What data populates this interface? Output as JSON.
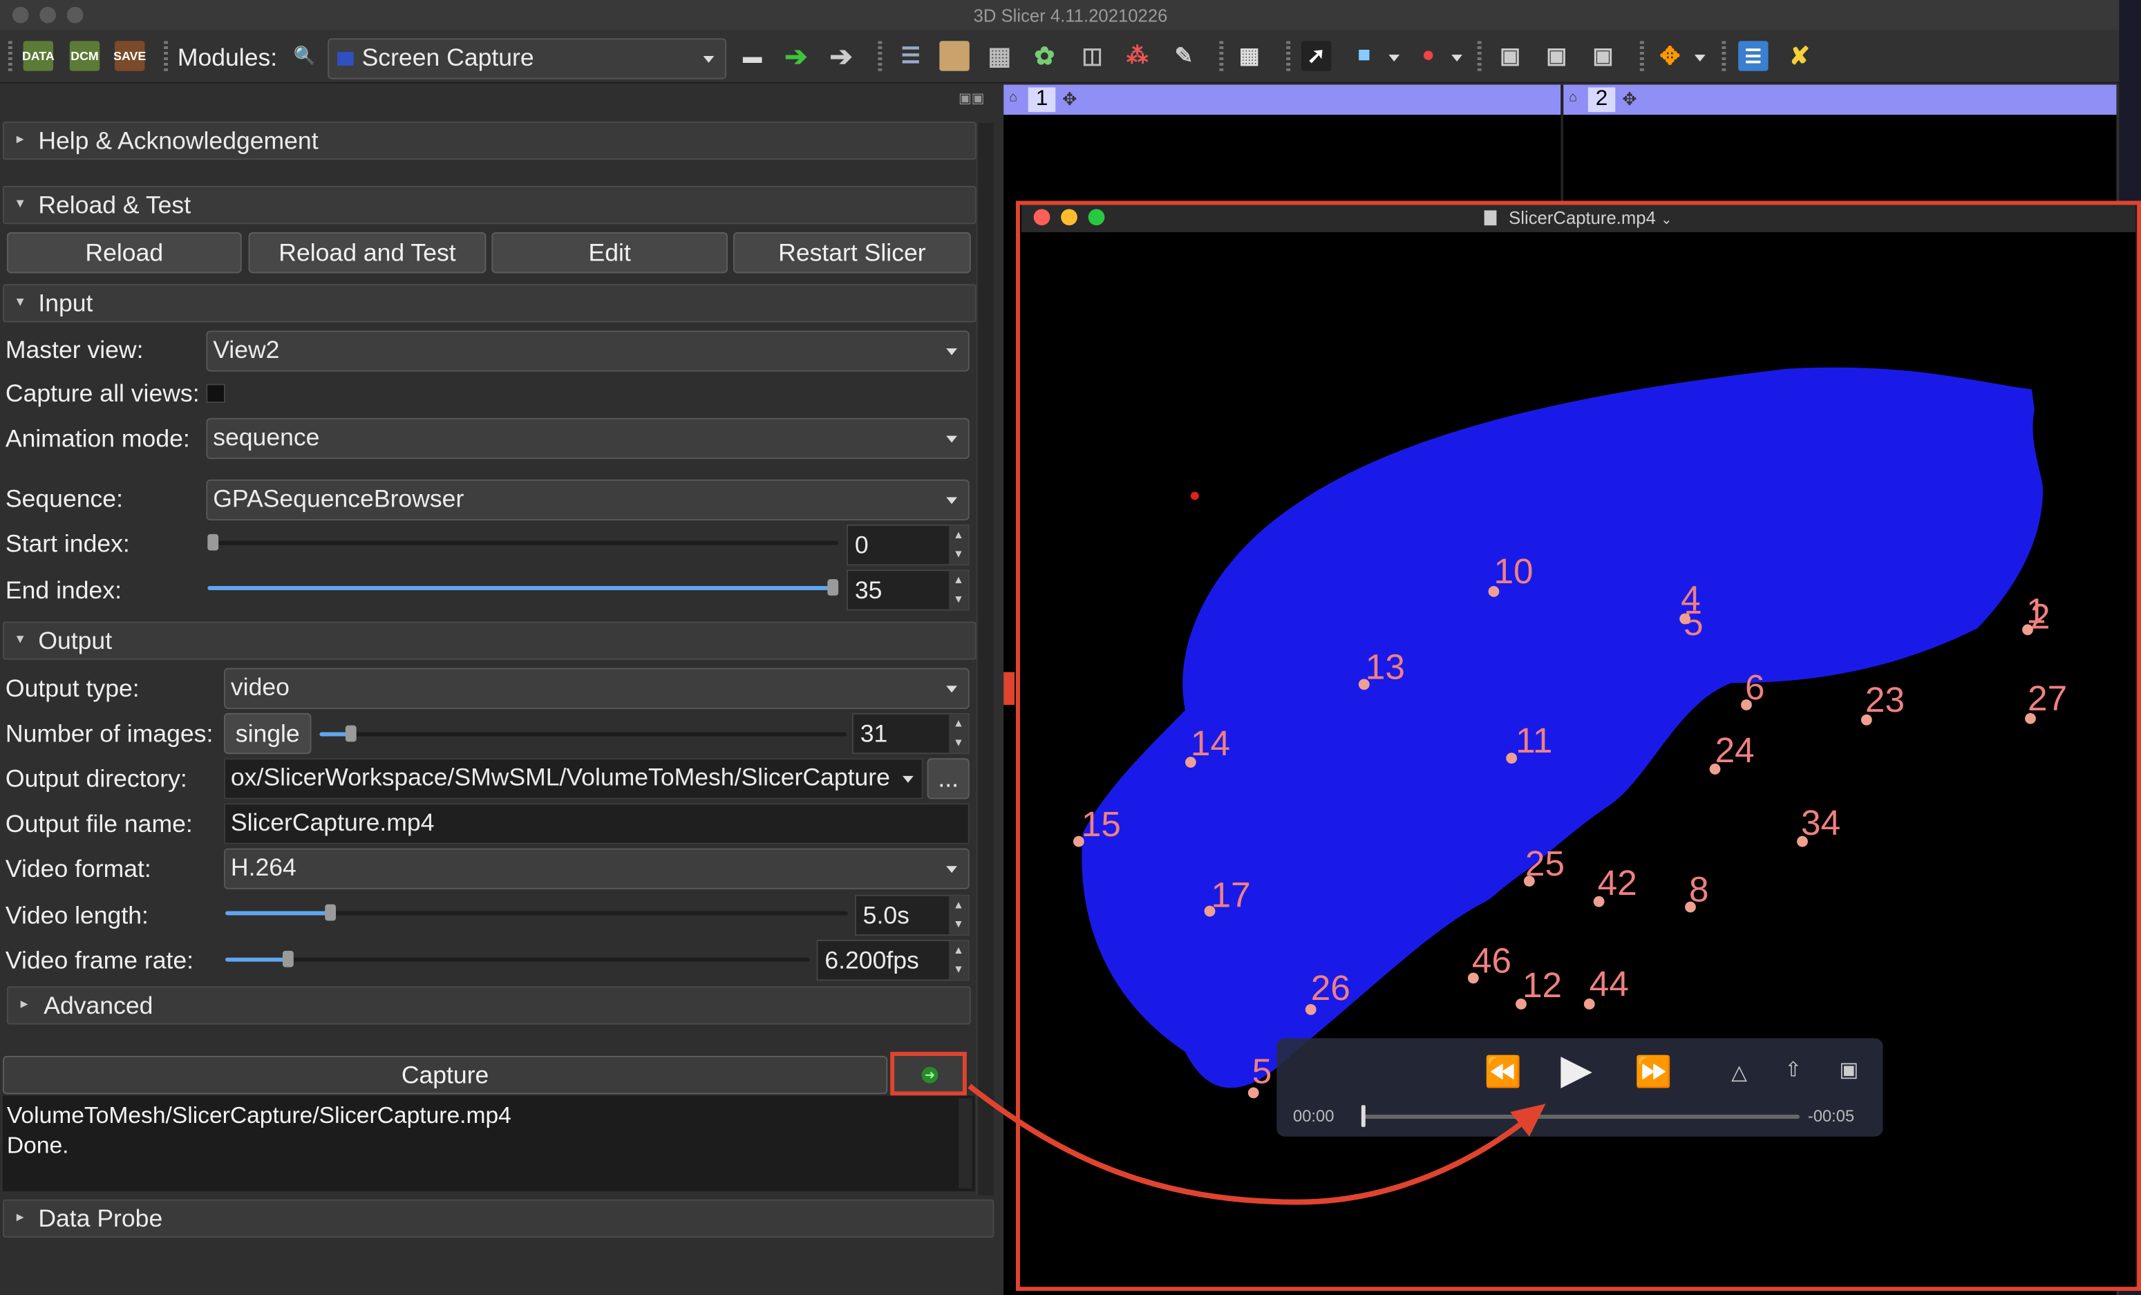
{
  "window": {
    "title": "3D Slicer 4.11.20210226"
  },
  "toolbar": {
    "data_label": "DATA",
    "dcm_label": "DCM",
    "save_label": "SAVE",
    "modules_label": "Modules:",
    "module_selected": "Screen Capture"
  },
  "sections": {
    "help": "Help & Acknowledgement",
    "reload": "Reload & Test",
    "input": "Input",
    "output": "Output",
    "advanced": "Advanced",
    "data_probe": "Data Probe"
  },
  "reload_buttons": {
    "reload": "Reload",
    "reload_test": "Reload and Test",
    "edit": "Edit",
    "restart": "Restart Slicer"
  },
  "input": {
    "master_view_label": "Master view:",
    "master_view": "View2",
    "capture_all_label": "Capture all views:",
    "capture_all_checked": false,
    "animation_mode_label": "Animation mode:",
    "animation_mode": "sequence",
    "sequence_label": "Sequence:",
    "sequence": "GPASequenceBrowser",
    "start_index_label": "Start index:",
    "start_index": "0",
    "end_index_label": "End index:",
    "end_index": "35"
  },
  "output": {
    "output_type_label": "Output type:",
    "output_type": "video",
    "num_images_label": "Number of images:",
    "num_images_mode": "single",
    "num_images": "31",
    "output_dir_label": "Output directory:",
    "output_dir": "ox/SlicerWorkspace/SMwSML/VolumeToMesh/SlicerCapture",
    "browse_label": "...",
    "file_name_label": "Output file name:",
    "file_name": "SlicerCapture.mp4",
    "video_format_label": "Video format:",
    "video_format": "H.264",
    "video_length_label": "Video length:",
    "video_length": "5.0s",
    "frame_rate_label": "Video frame rate:",
    "frame_rate": "6.200fps"
  },
  "capture": {
    "label": "Capture"
  },
  "log": {
    "line1": "VolumeToMesh/SlicerCapture/SlicerCapture.mp4",
    "line2": "Done."
  },
  "views": {
    "view1": "1",
    "view2": "2"
  },
  "player": {
    "title": "SlicerCapture.mp4",
    "time_elapsed": "00:00",
    "time_remaining": "-00:05",
    "progress": 0
  },
  "landmarks": [
    "10",
    "4",
    "5",
    "1",
    "2",
    "13",
    "6",
    "23",
    "27",
    "14",
    "11",
    "24",
    "15",
    "34",
    "25",
    "42",
    "8",
    "17",
    "46",
    "12",
    "44",
    "26",
    "5"
  ],
  "colors": {
    "accent": "#e0442f",
    "mesh": "#1a1ae8",
    "landmark": "#f08080",
    "view_bar": "#8f8ff5"
  }
}
